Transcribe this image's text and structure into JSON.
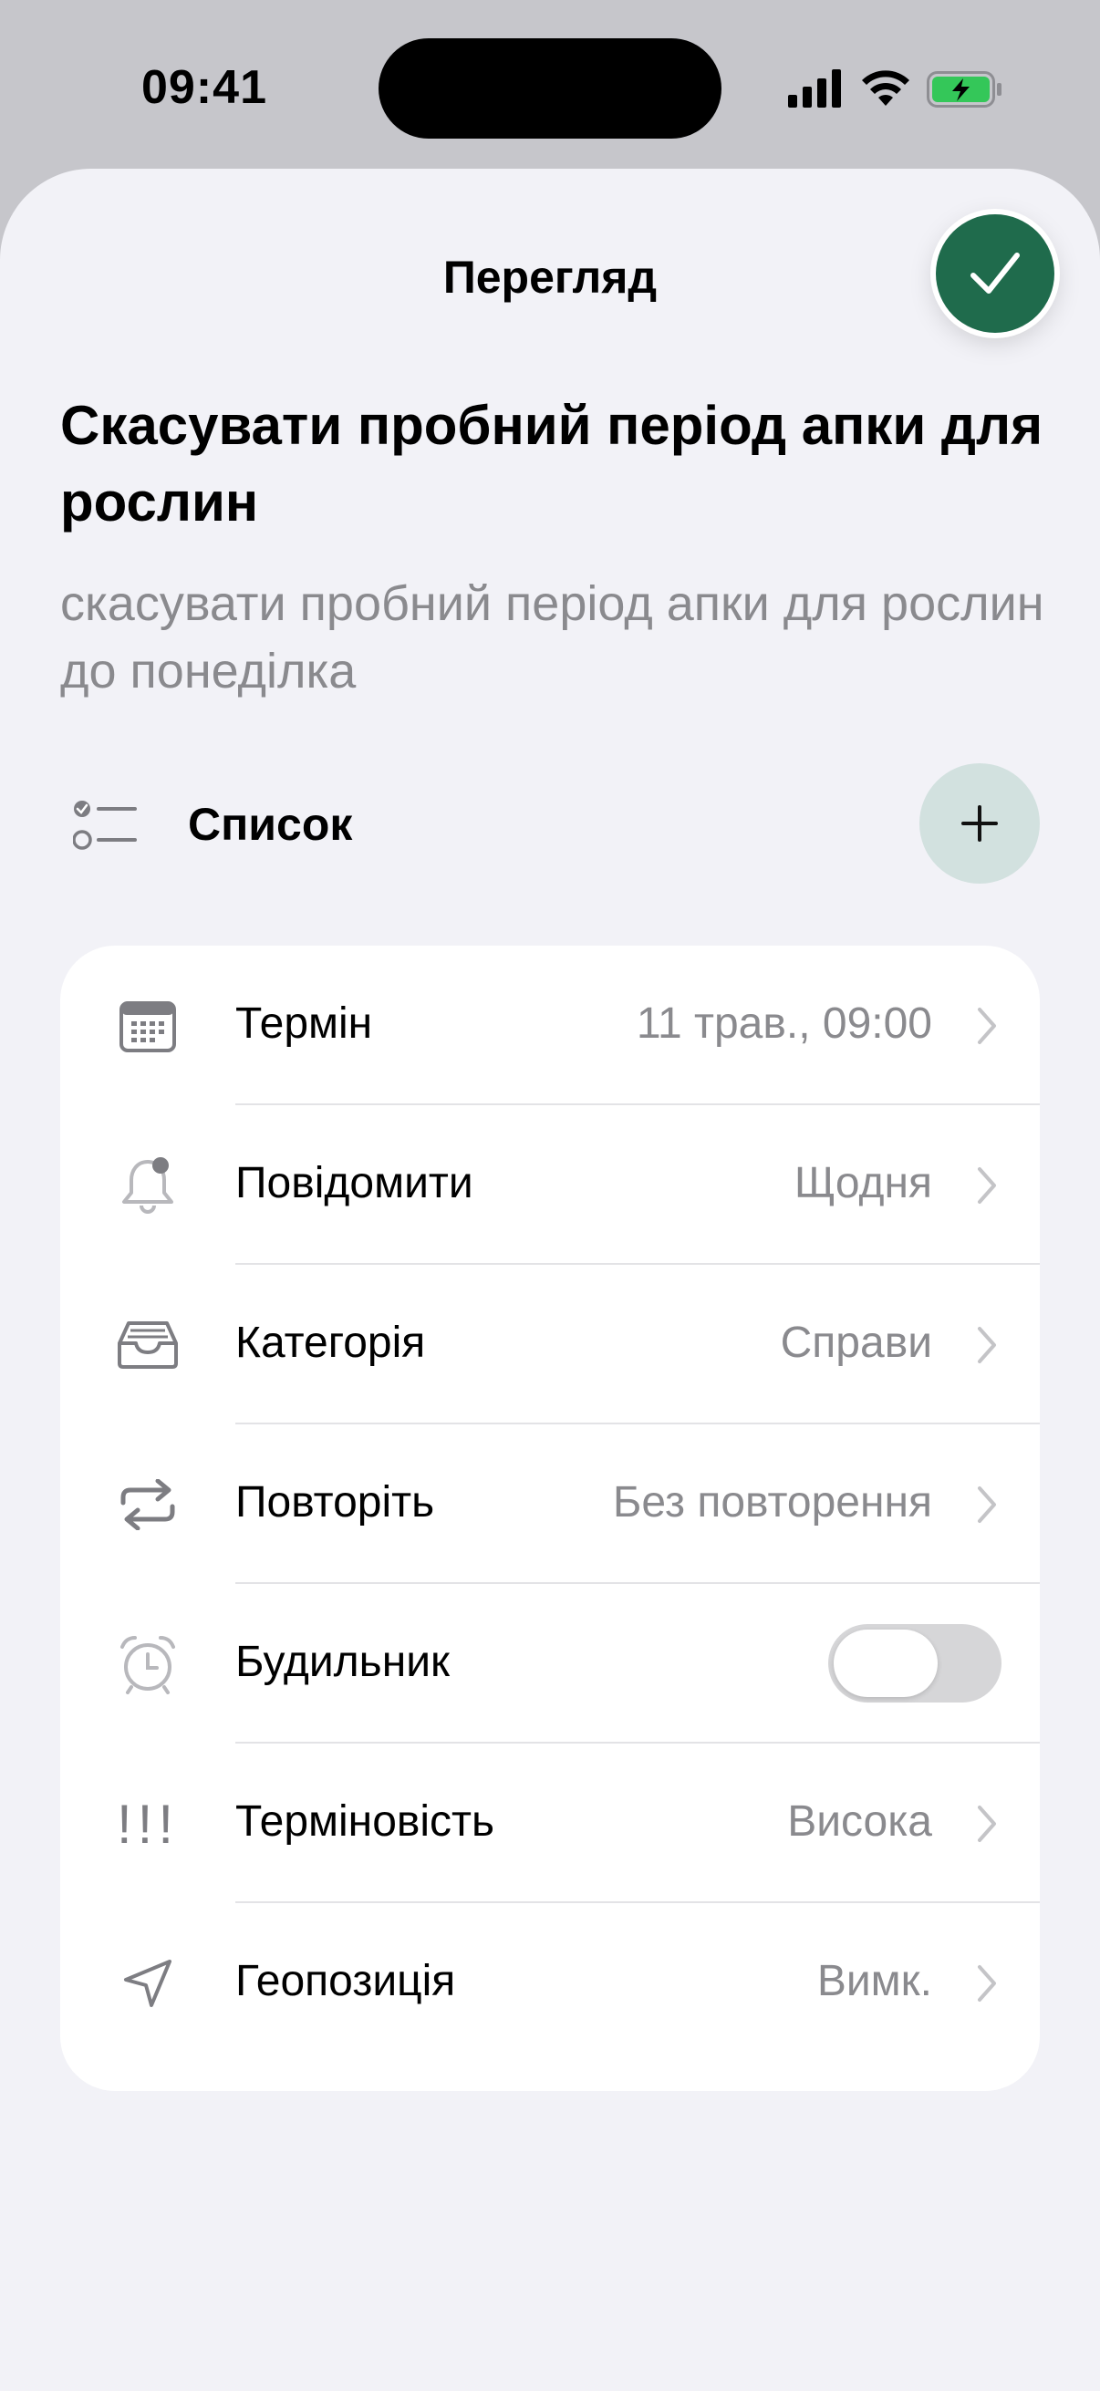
{
  "status_bar": {
    "time": "09:41"
  },
  "sheet": {
    "title": "Перегляд",
    "task_title": "Скасувати пробний період апки для рослин",
    "task_note": "скасувати пробний період апки для рослин до понеділка",
    "list_label": "Список"
  },
  "details": {
    "rows": [
      {
        "label": "Термін",
        "value": "11 трав., 09:00",
        "icon": "calendar-icon"
      },
      {
        "label": "Повідомити",
        "value": "Щодня",
        "icon": "bell-icon"
      },
      {
        "label": "Категорія",
        "value": "Справи",
        "icon": "tray-icon"
      },
      {
        "label": "Повторіть",
        "value": "Без повторення",
        "icon": "repeat-icon"
      },
      {
        "label": "Будильник",
        "value": "",
        "icon": "alarm-icon",
        "toggle_on": false
      },
      {
        "label": "Терміновість",
        "value": "Висока",
        "icon": "urgency-icon",
        "glyph": "!!!"
      },
      {
        "label": "Геопозиція",
        "value": "Вимк.",
        "icon": "location-arrow-icon"
      }
    ]
  },
  "colors": {
    "accent_green": "#1f6b4c",
    "add_button_bg": "#d2e1df",
    "sheet_bg": "#f2f2f7",
    "secondary_text": "#8a8a8e"
  }
}
